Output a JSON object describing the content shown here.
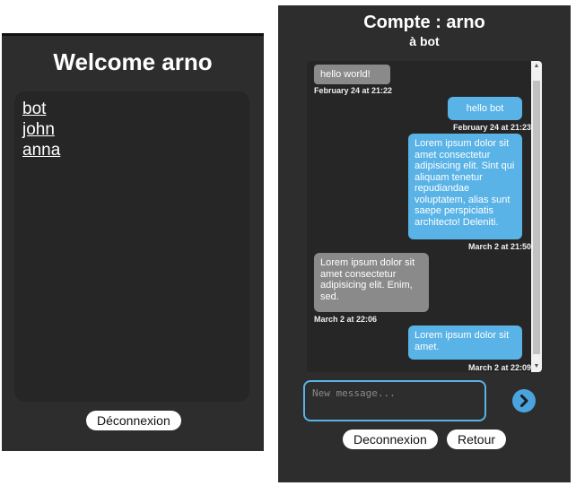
{
  "left": {
    "title": "Welcome arno",
    "contacts": [
      "bot",
      "john",
      "anna"
    ],
    "logout_label": "Déconnexion"
  },
  "chat": {
    "title": "Compte : arno",
    "subtitle": "à bot",
    "messages": [
      {
        "direction": "received",
        "text": "hello world!",
        "time": "February 24 at 21:22"
      },
      {
        "direction": "sent",
        "text": "hello bot",
        "time": "February 24 at 21:23"
      },
      {
        "direction": "sent",
        "text": "Lorem ipsum dolor sit amet consectetur adipisicing elit. Sint qui aliquam tenetur repudiandae voluptatem, alias sunt saepe perspiciatis architecto! Deleniti.",
        "time": "March 2 at 21:50"
      },
      {
        "direction": "received",
        "text": "Lorem ipsum dolor sit amet consectetur adipisicing elit. Enim, sed.",
        "time": "March 2 at 22:06"
      },
      {
        "direction": "sent",
        "text": "Lorem ipsum dolor sit amet.",
        "time": "March 2 at 22:09"
      }
    ],
    "input_placeholder": "New message...",
    "logout_label": "Deconnexion",
    "back_label": "Retour"
  },
  "colors": {
    "panel_bg": "#2d2d2d",
    "box_bg": "#262626",
    "sent_bubble": "#5ab3e6",
    "received_bubble": "#8a8a8a",
    "accent": "#4aa3dc"
  },
  "icons": {
    "send": "chevron-right-circle-icon",
    "scroll_up": "triangle-up-icon",
    "scroll_down": "triangle-down-icon"
  }
}
